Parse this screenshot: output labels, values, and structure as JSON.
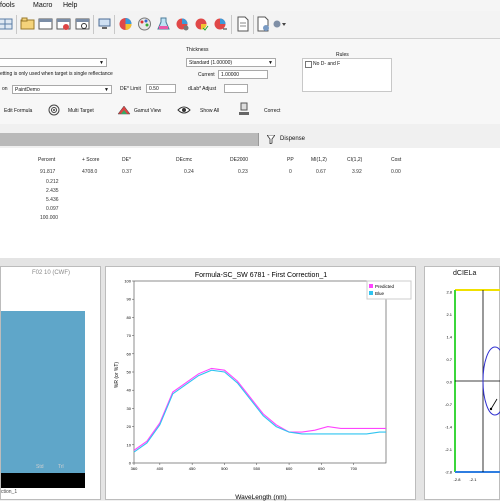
{
  "menu": {
    "tools": "fools",
    "macro": "Macro",
    "help": "Help"
  },
  "panel": {
    "target_note": "etting is only used when target is single reflectance",
    "ink_system": "PaintDemo",
    "thickness_label": "Thickness",
    "thickness_select": "Standard (1.00000)",
    "current_label": "Current",
    "current_value": "1.00000",
    "rules_label": "Rules",
    "rules_item": "No D- and F",
    "de_limit_label": "DE* Limit",
    "de_limit_value": "0.50",
    "dlab_adjust_label": "dLab* Adjust",
    "edit_formula": "Edit Formula",
    "multi_target": "Multi Target",
    "gamut_view": "Gamut View",
    "show_all": "Show All",
    "correct": "Correct",
    "dispense": "Dispense"
  },
  "table": {
    "headers": [
      "Percent",
      "+ Score",
      "DE*",
      "DEcmc",
      "DE2000",
      "PP",
      "MI(1,2)",
      "CI(1,2)",
      "Cost"
    ],
    "row1": [
      "91.817",
      "4708.0",
      "0.37",
      "0.24",
      "0.23",
      "0",
      "0.67",
      "3.92",
      "0.00"
    ],
    "percents": [
      "0.212",
      "2.435",
      "5.436",
      "0.097",
      "100.000"
    ]
  },
  "left_pane": {
    "title": "F02 10 (CWF)",
    "labels": [
      "Std",
      "Trl"
    ],
    "footer": "ction_1"
  },
  "chart_data": {
    "type": "line",
    "title": "Formula-SC_SW 6781 - First Correction_1",
    "xlabel": "WaveLength (nm)",
    "ylabel": "%R (or %T)",
    "xlim": [
      360,
      750
    ],
    "ylim": [
      0,
      100
    ],
    "xticks": [
      360,
      400,
      450,
      500,
      550,
      600,
      650,
      700
    ],
    "yticks": [
      0,
      10,
      20,
      30,
      40,
      50,
      60,
      70,
      80,
      90,
      100
    ],
    "x": [
      360,
      380,
      400,
      420,
      440,
      460,
      480,
      500,
      520,
      540,
      560,
      580,
      600,
      620,
      640,
      660,
      680,
      700,
      720,
      740,
      750
    ],
    "series": [
      {
        "name": "Predicted",
        "color": "#ff44ff",
        "values": [
          7,
          12,
          22,
          39,
          44,
          49,
          52,
          51,
          45,
          36,
          27,
          21,
          17,
          17,
          18,
          20,
          19,
          19,
          19,
          19,
          19
        ]
      },
      {
        "name": "Blue",
        "color": "#2fc4f0",
        "values": [
          6,
          11,
          21,
          38,
          43,
          48,
          51,
          50,
          44,
          35,
          26,
          20,
          17,
          16,
          16,
          16,
          16,
          16,
          16,
          17,
          17
        ]
      }
    ]
  },
  "right_pane": {
    "title": "dCIELa",
    "yticks": [
      "2.8",
      "2.1",
      "1.4",
      "0.7",
      "0.0",
      "-0.7",
      "-1.4",
      "-2.1",
      "-2.8"
    ],
    "xticks": [
      "-2.8",
      "-2.1"
    ]
  },
  "colors": {
    "swatch": "#5fa6c9",
    "predicted": "#ff44ff",
    "blue": "#2fc4f0"
  }
}
